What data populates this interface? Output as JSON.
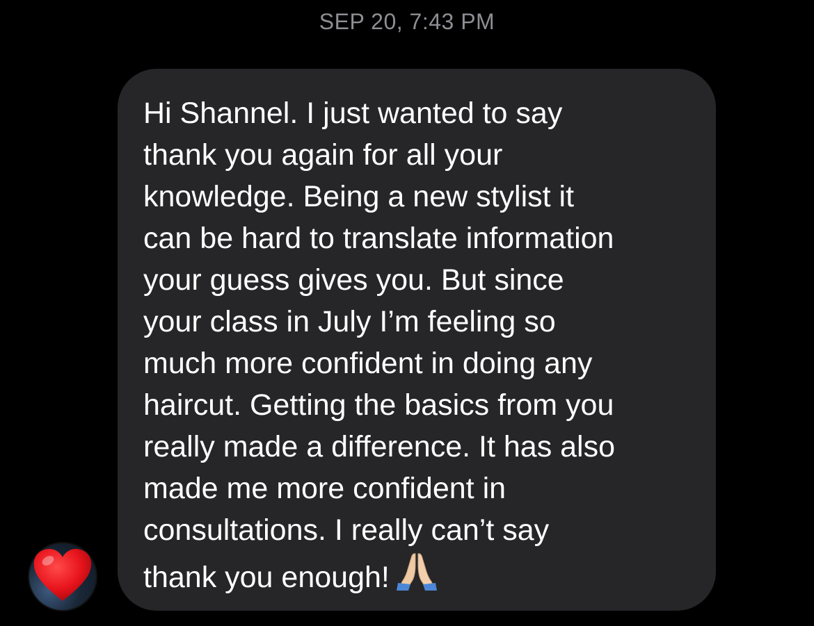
{
  "conversation": {
    "timestamp": "SEP 20, 7:43 PM"
  },
  "message": {
    "lines": [
      "Hi Shannel. I just wanted to say",
      "thank you again for all your",
      "knowledge. Being a new stylist it",
      "can be hard to translate information",
      "your guess gives you. But since",
      "your class in July I’m feeling so",
      "much more confident in doing any",
      "haircut. Getting the basics from you",
      "really made a difference. It has also",
      "made me more confident in",
      "consultations. I really can’t say",
      "thank you enough!"
    ],
    "trailing_emoji": "folded-hands-icon",
    "bubble_color": "#262628",
    "text_color": "#ffffff"
  },
  "reaction": {
    "icon": "red-heart-icon",
    "color": "#e8141c"
  },
  "colors": {
    "background": "#000000",
    "timestamp": "#8e8e93"
  }
}
